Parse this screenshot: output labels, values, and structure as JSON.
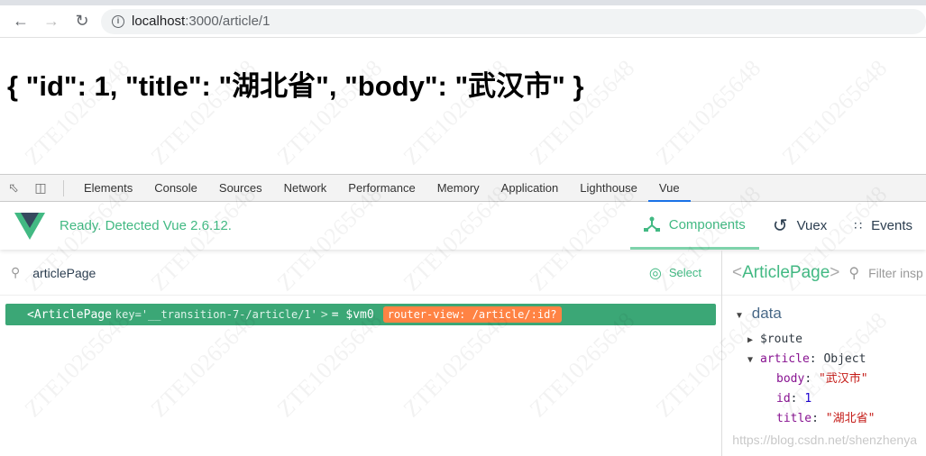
{
  "browser": {
    "url_host": "localhost",
    "url_path": ":3000/article/1"
  },
  "page": {
    "content": "{ \"id\": 1, \"title\": \"湖北省\", \"body\": \"武汉市\" }"
  },
  "devtools": {
    "tabs": [
      "Elements",
      "Console",
      "Sources",
      "Network",
      "Performance",
      "Memory",
      "Application",
      "Lighthouse",
      "Vue"
    ],
    "active": "Vue"
  },
  "vue": {
    "status": "Ready. Detected Vue 2.6.12.",
    "tabs": [
      {
        "label": "Components",
        "active": true
      },
      {
        "label": "Vuex"
      },
      {
        "label": "Events"
      }
    ],
    "search_value": "articlePage",
    "select_label": "Select",
    "component_row": {
      "name": "<ArticlePage",
      "key_attr": "key='__transition-7-/article/1'",
      "close": ">",
      "vm": "= $vm0",
      "badge": "router-view: /article/:id?"
    },
    "inspector": {
      "name": "ArticlePage",
      "filter_placeholder": "Filter inspected data",
      "section": "data",
      "route": "$route",
      "article_key": "article",
      "article_type": "Object",
      "body_key": "body",
      "body_val": "\"武汉市\"",
      "id_key": "id",
      "id_val": "1",
      "title_key": "title",
      "title_val": "\"湖北省\""
    }
  },
  "watermark": {
    "text": "ZTE10265648",
    "source": "https://blog.csdn.net/shenzhenya"
  },
  "colors": {
    "vue_green": "#42b983",
    "row_green": "#3ba776",
    "badge_orange": "#ff8344"
  }
}
